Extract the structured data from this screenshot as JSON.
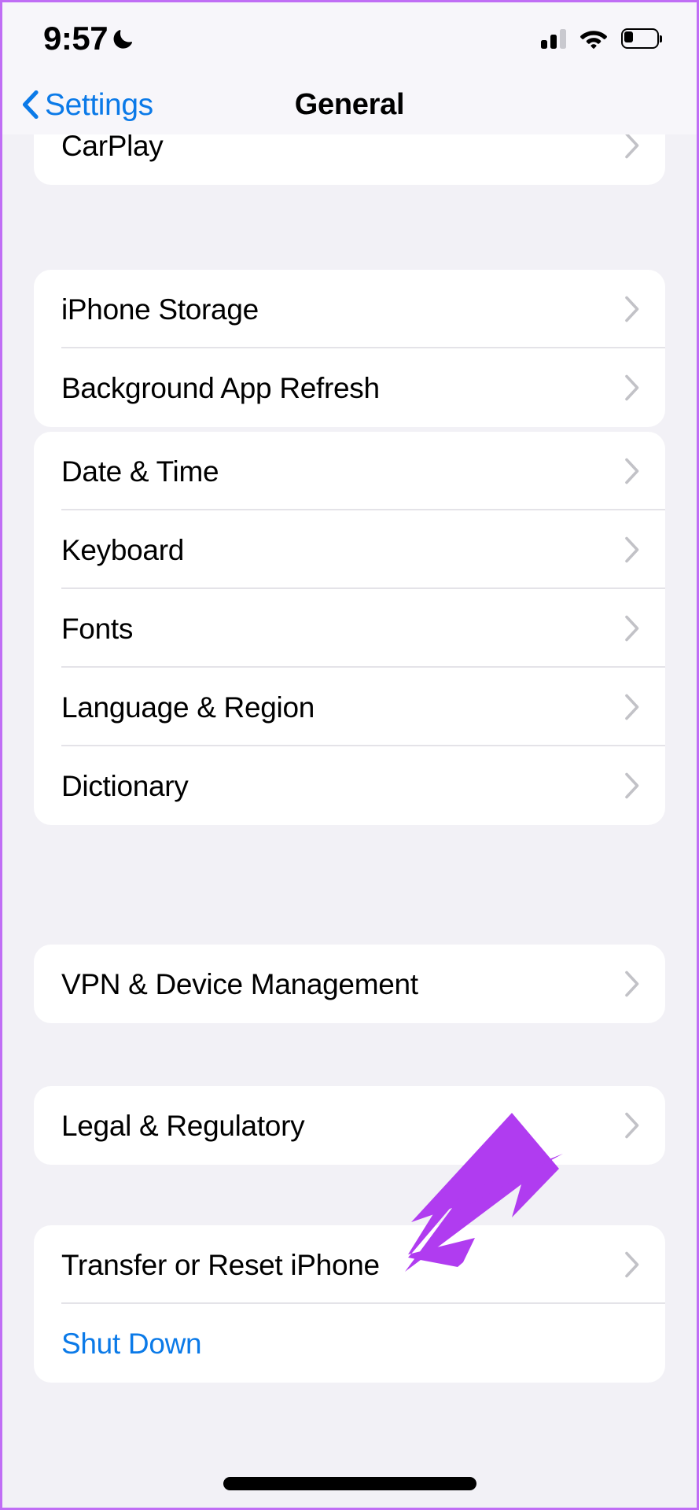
{
  "status_bar": {
    "time": "9:57",
    "dnd_icon": "crescent-moon-icon",
    "signal_icon": "cellular-signal-icon",
    "signal_bars_filled": 2,
    "signal_bars_total": 3,
    "wifi_icon": "wifi-icon",
    "battery_icon": "battery-low-icon",
    "battery_level_percent": 25
  },
  "nav": {
    "back_label": "Settings",
    "back_icon": "chevron-left-icon",
    "title": "General"
  },
  "groups": [
    {
      "id": "carplay-group",
      "clipped_top": true,
      "rows": [
        {
          "label": "CarPlay",
          "accessory": "chevron-right-icon",
          "style": "default"
        }
      ]
    },
    {
      "id": "storage-group",
      "clipped_top": false,
      "rows": [
        {
          "label": "iPhone Storage",
          "accessory": "chevron-right-icon",
          "style": "default"
        },
        {
          "label": "Background App Refresh",
          "accessory": "chevron-right-icon",
          "style": "default"
        }
      ]
    },
    {
      "id": "locale-group",
      "clipped_top": false,
      "rows": [
        {
          "label": "Date & Time",
          "accessory": "chevron-right-icon",
          "style": "default"
        },
        {
          "label": "Keyboard",
          "accessory": "chevron-right-icon",
          "style": "default"
        },
        {
          "label": "Fonts",
          "accessory": "chevron-right-icon",
          "style": "default"
        },
        {
          "label": "Language & Region",
          "accessory": "chevron-right-icon",
          "style": "default"
        },
        {
          "label": "Dictionary",
          "accessory": "chevron-right-icon",
          "style": "default"
        }
      ]
    },
    {
      "id": "vpn-group",
      "clipped_top": false,
      "rows": [
        {
          "label": "VPN & Device Management",
          "accessory": "chevron-right-icon",
          "style": "default"
        }
      ]
    },
    {
      "id": "legal-group",
      "clipped_top": false,
      "rows": [
        {
          "label": "Legal & Regulatory",
          "accessory": "chevron-right-icon",
          "style": "default"
        }
      ]
    },
    {
      "id": "reset-group",
      "clipped_top": false,
      "rows": [
        {
          "label": "Transfer or Reset iPhone",
          "accessory": "chevron-right-icon",
          "style": "default"
        },
        {
          "label": "Shut Down",
          "accessory": "none",
          "style": "blue"
        }
      ]
    }
  ],
  "annotation": {
    "type": "arrow",
    "icon": "purple-pointer-arrow",
    "points_to": "Transfer or Reset iPhone",
    "color": "#b03cf0"
  },
  "colors": {
    "accent_blue": "#0b7ae8",
    "page_background": "#f2f1f6",
    "card_background": "#ffffff",
    "bar_background": "#f7f6fa",
    "separator": "#e4e3e8",
    "chevron_gray": "#c2c2c7",
    "annotation_purple": "#b03cf0",
    "device_frame": "#c06ef5"
  },
  "home_indicator": "home-indicator-bar"
}
